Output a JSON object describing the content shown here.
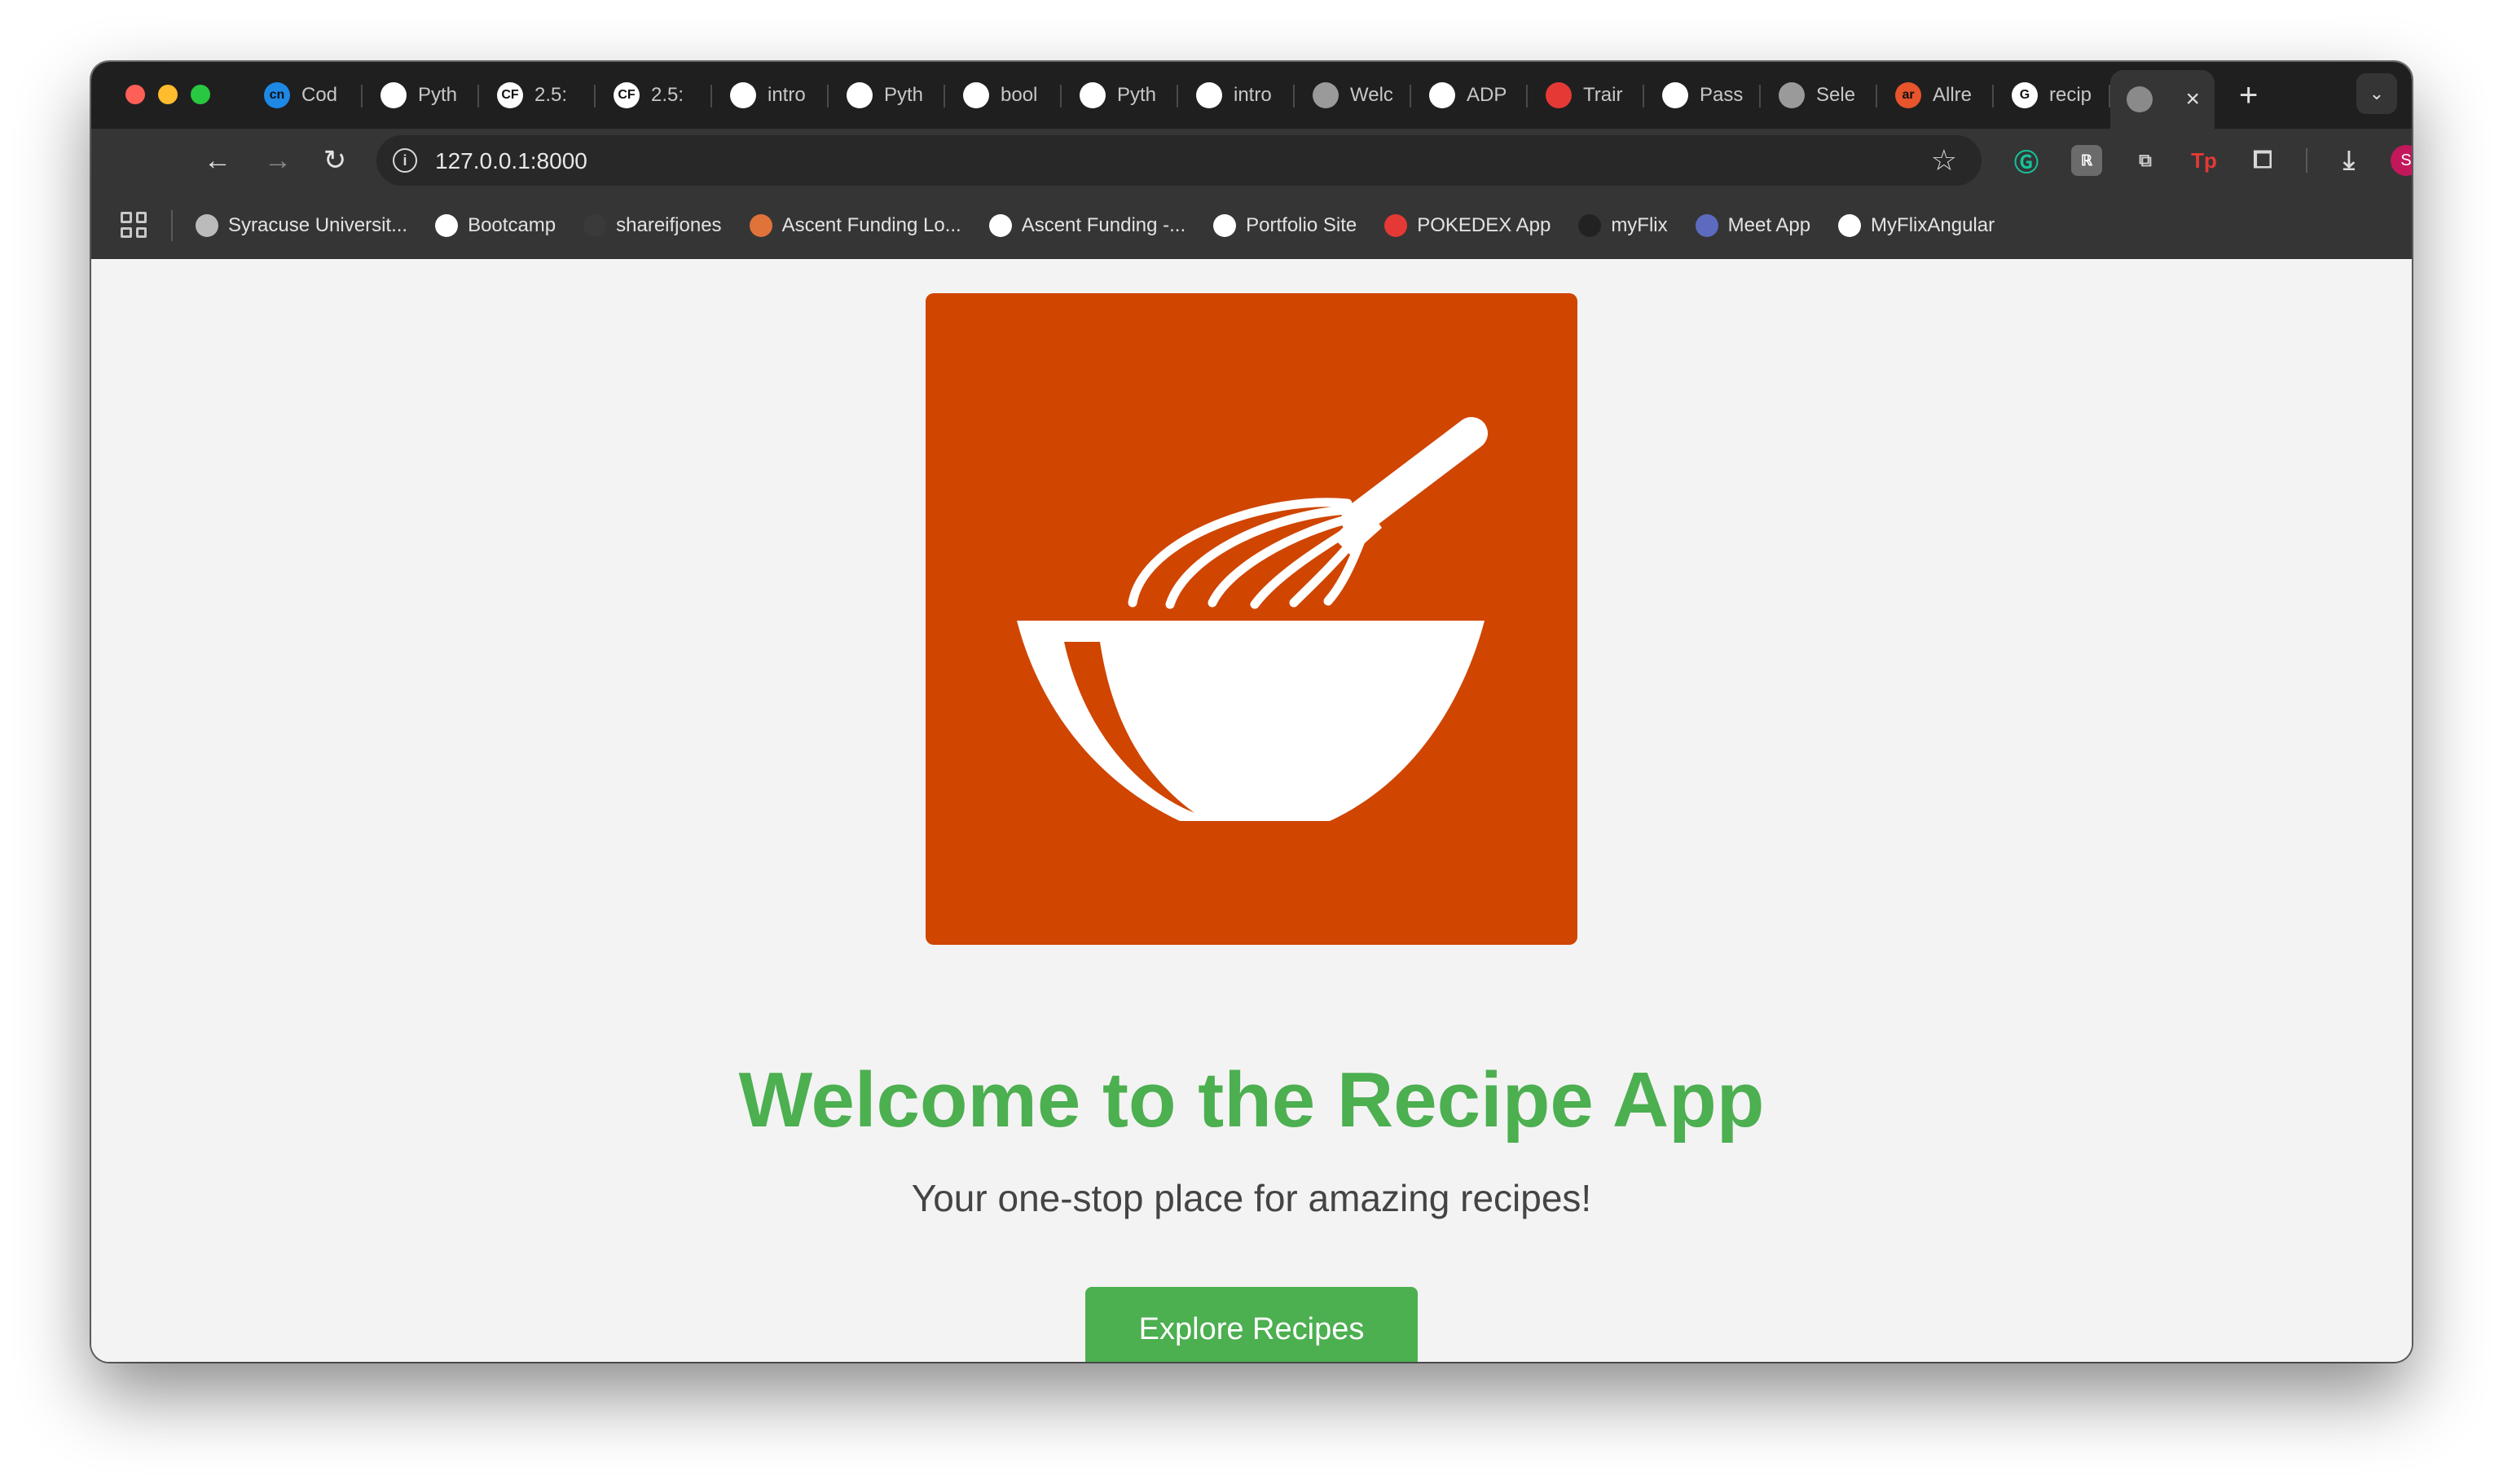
{
  "browser": {
    "tabs": [
      {
        "label": "Cod",
        "icon": "codecademy-icon",
        "color": "#1e88e5",
        "glyph": "cn"
      },
      {
        "label": "Pyth",
        "icon": "github-icon",
        "color": "#ffffff",
        "glyph": ""
      },
      {
        "label": "2.5:",
        "icon": "careerfoundry-icon",
        "color": "#ffffff",
        "glyph": "CF"
      },
      {
        "label": "2.5:",
        "icon": "careerfoundry-icon",
        "color": "#ffffff",
        "glyph": "CF"
      },
      {
        "label": "intro",
        "icon": "github-icon",
        "color": "#ffffff",
        "glyph": ""
      },
      {
        "label": "Pyth",
        "icon": "github-icon",
        "color": "#ffffff",
        "glyph": ""
      },
      {
        "label": "bool",
        "icon": "github-icon",
        "color": "#ffffff",
        "glyph": ""
      },
      {
        "label": "Pyth",
        "icon": "github-icon",
        "color": "#ffffff",
        "glyph": ""
      },
      {
        "label": "intro",
        "icon": "github-icon",
        "color": "#ffffff",
        "glyph": ""
      },
      {
        "label": "Welc",
        "icon": "globe-icon",
        "color": "#9a9a9a",
        "glyph": ""
      },
      {
        "label": "ADP",
        "icon": "adp-icon",
        "color": "#ffffff",
        "glyph": ""
      },
      {
        "label": "Trair",
        "icon": "training-icon",
        "color": "#e53935",
        "glyph": ""
      },
      {
        "label": "Pass",
        "icon": "pass-icon",
        "color": "#ffffff",
        "glyph": ""
      },
      {
        "label": "Sele",
        "icon": "globe-icon",
        "color": "#9a9a9a",
        "glyph": ""
      },
      {
        "label": "Allre",
        "icon": "allrecipes-icon",
        "color": "#e8542b",
        "glyph": "ar"
      },
      {
        "label": "recip",
        "icon": "google-icon",
        "color": "#ffffff",
        "glyph": "G"
      }
    ],
    "active_tab": {
      "icon": "globe-icon"
    },
    "url": "127.0.0.1:8000",
    "profile_initial": "S",
    "bookmarks": [
      {
        "label": "Syracuse Universit...",
        "icon": "globe-icon",
        "color": "#bbbbbb"
      },
      {
        "label": "Bootcamp",
        "icon": "careerfoundry-icon",
        "color": "#ffffff"
      },
      {
        "label": "shareifjones",
        "icon": "github-icon",
        "color": "#3a3a3a"
      },
      {
        "label": "Ascent Funding Lo...",
        "icon": "ascent-icon",
        "color": "#e0733a"
      },
      {
        "label": "Ascent Funding -...",
        "icon": "ascent-icon",
        "color": "#ffffff"
      },
      {
        "label": "Portfolio Site",
        "icon": "portfolio-icon",
        "color": "#ffffff"
      },
      {
        "label": "POKEDEX App",
        "icon": "pokeball-icon",
        "color": "#e53935"
      },
      {
        "label": "myFlix",
        "icon": "myflix-icon",
        "color": "#222222"
      },
      {
        "label": "Meet App",
        "icon": "meet-icon",
        "color": "#5c6bc0"
      },
      {
        "label": "MyFlixAngular",
        "icon": "angular-icon",
        "color": "#ffffff"
      }
    ]
  },
  "page": {
    "hero_image": "whisk-bowl-logo",
    "title": "Welcome to the Recipe App",
    "subtitle": "Your one-stop place for amazing recipes!",
    "cta_label": "Explore Recipes",
    "colors": {
      "accent": "#4caf50",
      "logo_bg": "#d04500",
      "page_bg": "#f3f3f3"
    }
  }
}
